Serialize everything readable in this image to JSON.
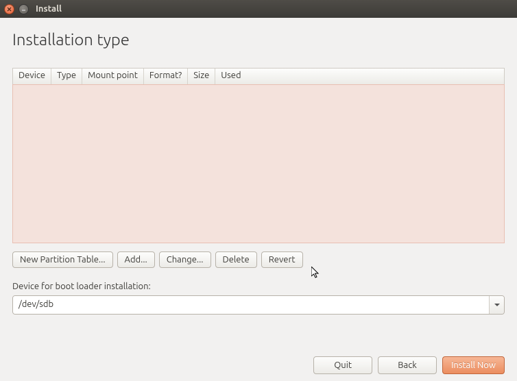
{
  "window": {
    "title": "Install"
  },
  "heading": "Installation type",
  "table": {
    "columns": [
      "Device",
      "Type",
      "Mount point",
      "Format?",
      "Size",
      "Used"
    ],
    "rows": []
  },
  "toolbar": {
    "new_table": "New Partition Table...",
    "add": "Add...",
    "change": "Change...",
    "delete": "Delete",
    "revert": "Revert"
  },
  "bootloader": {
    "label": "Device for boot loader installation:",
    "value": "/dev/sdb"
  },
  "footer": {
    "quit": "Quit",
    "back": "Back",
    "install": "Install Now"
  }
}
